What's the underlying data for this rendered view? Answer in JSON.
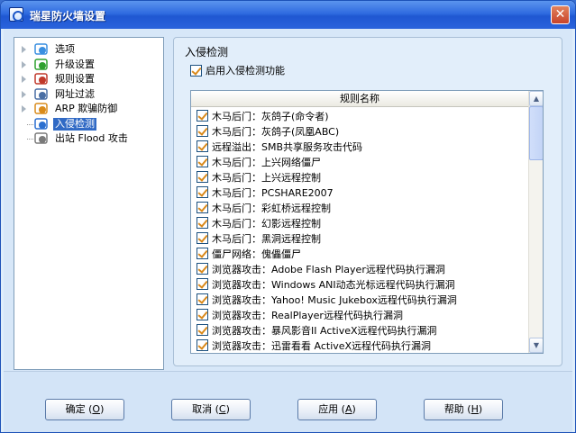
{
  "window": {
    "title": "瑞星防火墙设置",
    "close_symbol": "✕"
  },
  "tree": [
    {
      "label": "选项",
      "icon": "gear-icon",
      "expandable": true,
      "selected": false
    },
    {
      "label": "升级设置",
      "icon": "update-icon",
      "expandable": true,
      "selected": false
    },
    {
      "label": "规则设置",
      "icon": "rules-icon",
      "expandable": true,
      "selected": false
    },
    {
      "label": "网址过滤",
      "icon": "url-filter-icon",
      "expandable": true,
      "selected": false
    },
    {
      "label": "ARP 欺骗防御",
      "icon": "arp-icon",
      "expandable": true,
      "selected": false
    },
    {
      "label": "入侵检测",
      "icon": "intrusion-icon",
      "expandable": false,
      "selected": true
    },
    {
      "label": "出站 Flood 攻击",
      "icon": "flood-icon",
      "expandable": false,
      "selected": false
    }
  ],
  "section": {
    "title": "入侵检测",
    "enable_label": "启用入侵检测功能",
    "enable_checked": true,
    "list_header": "规则名称",
    "rules": [
      "木马后门：灰鸽子(命令者)",
      "木马后门：灰鸽子(凤凰ABC)",
      "远程溢出：SMB共享服务攻击代码",
      "木马后门：上兴网络僵尸",
      "木马后门：上兴远程控制",
      "木马后门：PCSHARE2007",
      "木马后门：彩虹桥远程控制",
      "木马后门：幻影远程控制",
      "木马后门：黑洞远程控制",
      "僵尸网络：傀儡僵尸",
      "浏览器攻击：Adobe Flash Player远程代码执行漏洞",
      "浏览器攻击：Windows ANI动态光标远程代码执行漏洞",
      "浏览器攻击：Yahoo! Music Jukebox远程代码执行漏洞",
      "浏览器攻击：RealPlayer远程代码执行漏洞",
      "浏览器攻击：暴风影音II ActiveX远程代码执行漏洞",
      "浏览器攻击：迅雷看看 ActiveX远程代码执行漏洞"
    ]
  },
  "buttons": [
    {
      "name": "ok-button",
      "text": "确定",
      "key": "O"
    },
    {
      "name": "cancel-button",
      "text": "取消",
      "key": "C"
    },
    {
      "name": "apply-button",
      "text": "应用",
      "key": "A"
    },
    {
      "name": "help-button",
      "text": "帮助",
      "key": "H"
    }
  ]
}
